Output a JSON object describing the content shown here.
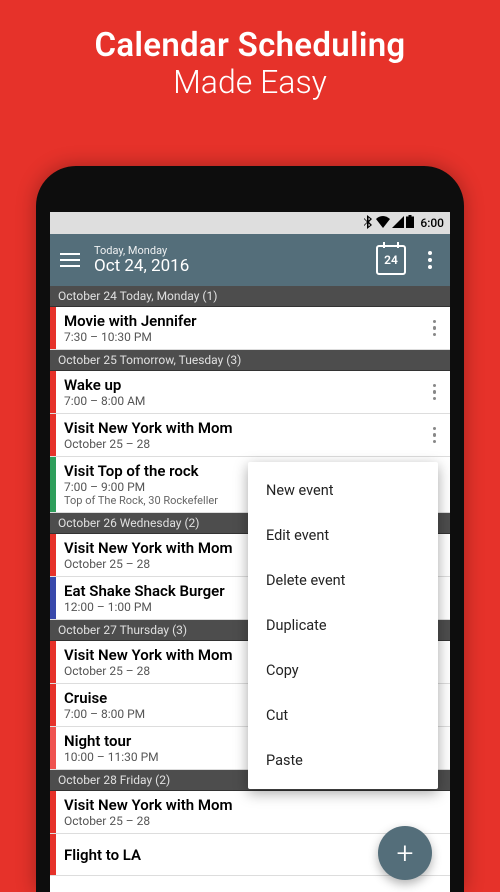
{
  "promo": {
    "title": "Calendar Scheduling",
    "subtitle": "Made Easy"
  },
  "status": {
    "time": "6:00"
  },
  "appbar": {
    "small": "Today, Monday",
    "large": "Oct 24, 2016",
    "cal_day": "24"
  },
  "sections": [
    {
      "header": "October 24 Today, Monday (1)",
      "events": [
        {
          "color": "#e6322a",
          "title": "Movie with Jennifer",
          "sub": "7:30 – 10:30 PM",
          "dots": true
        }
      ]
    },
    {
      "header": "October 25 Tomorrow, Tuesday (3)",
      "events": [
        {
          "color": "#e6322a",
          "title": "Wake up",
          "sub": "7:00 – 8:00 AM",
          "dots": true
        },
        {
          "color": "#e6322a",
          "title": "Visit New York with Mom",
          "sub": "October 25 – 28",
          "dots": true
        },
        {
          "color": "#2e9e5b",
          "title": "Visit Top of the rock",
          "sub": "7:00 – 9:00 PM",
          "loc": "Top of The Rock, 30 Rockefeller"
        }
      ]
    },
    {
      "header": "October 26 Wednesday (2)",
      "events": [
        {
          "color": "#e6322a",
          "title": "Visit New York with Mom",
          "sub": "October 25 – 28"
        },
        {
          "color": "#3949ab",
          "title": "Eat Shake Shack Burger",
          "sub": "12:00 – 1:00 PM"
        }
      ]
    },
    {
      "header": "October 27 Thursday (3)",
      "events": [
        {
          "color": "#e6322a",
          "title": "Visit New York with Mom",
          "sub": "October 25 – 28"
        },
        {
          "color": "#e6322a",
          "title": "Cruise",
          "sub": "7:00 – 8:00 PM"
        },
        {
          "color": "#ef5350",
          "title": "Night tour",
          "sub": "10:00 – 11:30 PM"
        }
      ]
    },
    {
      "header": "October 28 Friday (2)",
      "events": [
        {
          "color": "#e6322a",
          "title": "Visit New York with Mom",
          "sub": "October 25 – 28"
        },
        {
          "color": "#e6322a",
          "title": "Flight to LA",
          "sub": ""
        }
      ]
    }
  ],
  "menu": {
    "items": [
      {
        "label": "New event"
      },
      {
        "label": "Edit event"
      },
      {
        "label": "Delete event"
      },
      {
        "label": "Duplicate"
      },
      {
        "label": "Copy"
      },
      {
        "label": "Cut"
      },
      {
        "label": "Paste"
      }
    ]
  }
}
